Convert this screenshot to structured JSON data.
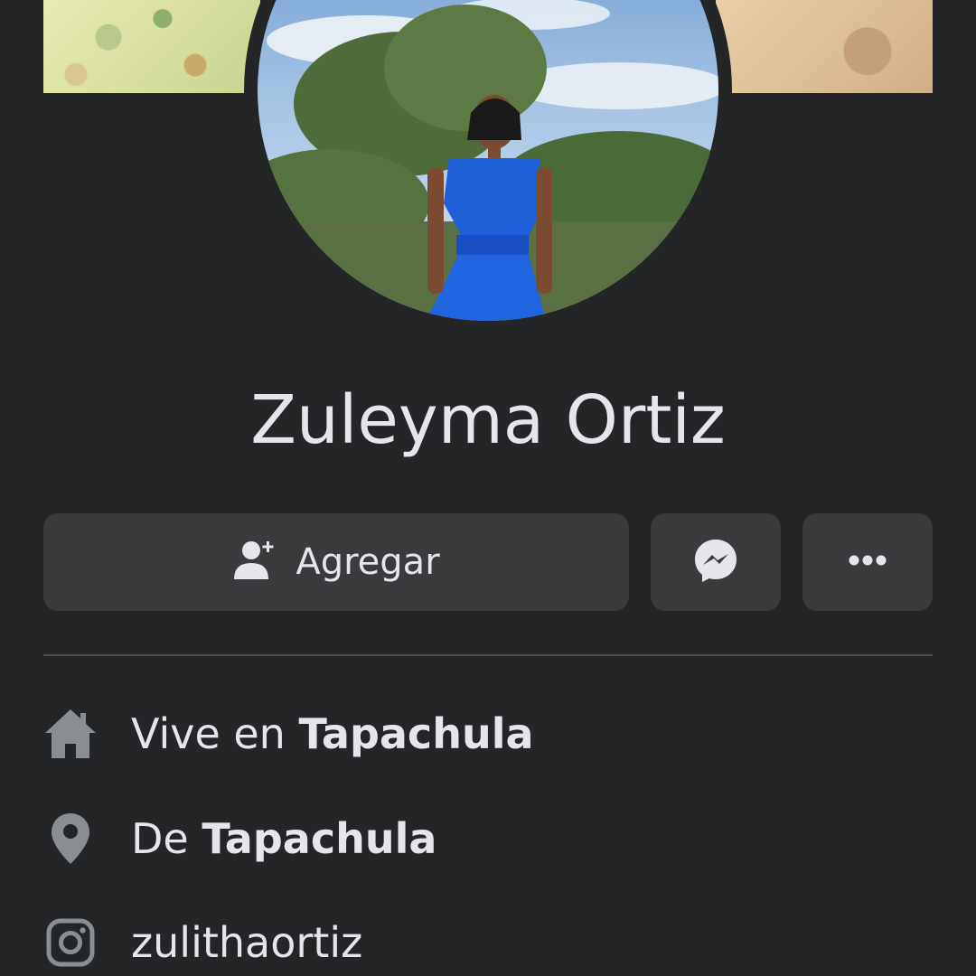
{
  "profile": {
    "name": "Zuleyma Ortiz"
  },
  "actions": {
    "add_label": "Agregar",
    "add_icon": "add-friend-icon",
    "message_icon": "messenger-icon",
    "more_icon": "more-dots-icon"
  },
  "info": [
    {
      "icon": "home-icon",
      "prefix": "Vive en",
      "value": "Tapachula"
    },
    {
      "icon": "location-pin-icon",
      "prefix": "De",
      "value": "Tapachula"
    },
    {
      "icon": "instagram-icon",
      "prefix": "",
      "value": "zulithaortiz"
    }
  ],
  "colors": {
    "background": "#242526",
    "button": "#3a3b3c",
    "text": "#e4e6eb",
    "icon": "#8a8d91"
  }
}
